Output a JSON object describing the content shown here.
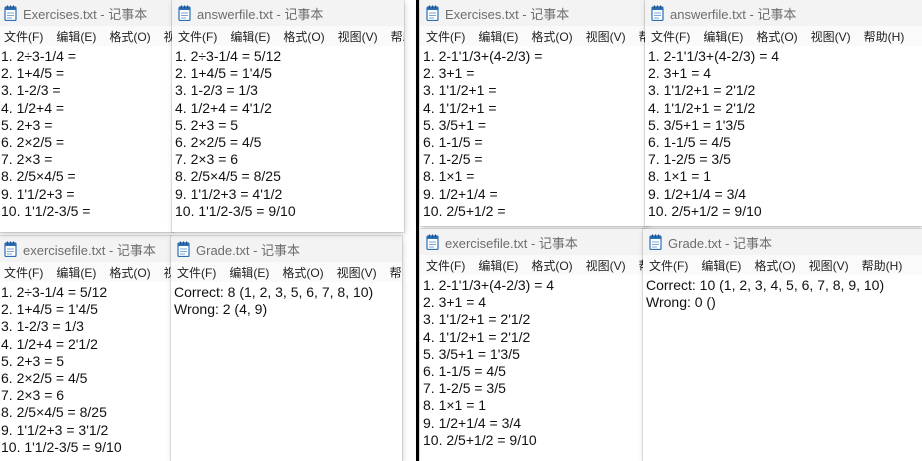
{
  "menu": [
    "文件(F)",
    "编辑(E)",
    "格式(O)",
    "视图(V)",
    "帮助(H)"
  ],
  "windows": {
    "left_exercises": {
      "title": "Exercises.txt - 记事本",
      "lines": [
        "1. 2÷3-1/4 =",
        "2. 1+4/5 =",
        "3. 1-2/3 =",
        "4. 1/2+4 =",
        "5. 2+3 =",
        "6. 2×2/5 =",
        "7. 2×3 =",
        "8. 2/5×4/5 =",
        "9. 1'1/2+3 =",
        "10. 1'1/2-3/5 ="
      ]
    },
    "left_answerfile": {
      "title": "answerfile.txt - 记事本",
      "lines": [
        "1. 2÷3-1/4 = 5/12",
        "2. 1+4/5 = 1'4/5",
        "3. 1-2/3 = 1/3",
        "4. 1/2+4 = 4'1/2",
        "5. 2+3 = 5",
        "6. 2×2/5 = 4/5",
        "7. 2×3 = 6",
        "8. 2/5×4/5 = 8/25",
        "9. 1'1/2+3 = 4'1/2",
        "10. 1'1/2-3/5 = 9/10"
      ]
    },
    "left_exercisefile": {
      "title": "exercisefile.txt - 记事本",
      "lines": [
        "1. 2÷3-1/4 = 5/12",
        "2. 1+4/5 = 1'4/5",
        "3. 1-2/3 = 1/3",
        "4. 1/2+4 = 2'1/2",
        "5. 2+3 = 5",
        "6. 2×2/5 = 4/5",
        "7. 2×3 = 6",
        "8. 2/5×4/5 = 8/25",
        "9. 1'1/2+3 = 3'1/2",
        "10. 1'1/2-3/5 = 9/10"
      ]
    },
    "left_grade": {
      "title": "Grade.txt - 记事本",
      "lines": [
        "Correct: 8 (1, 2, 3, 5, 6, 7, 8, 10)",
        "Wrong: 2 (4, 9)"
      ]
    },
    "right_exercises": {
      "title": "Exercises.txt - 记事本",
      "lines": [
        "1. 2-1'1/3+(4-2/3) =",
        "2. 3+1 =",
        "3. 1'1/2+1 =",
        "4. 1'1/2+1 =",
        "5. 3/5+1 =",
        "6. 1-1/5 =",
        "7. 1-2/5 =",
        "8. 1×1 =",
        "9. 1/2+1/4 =",
        "10. 2/5+1/2 ="
      ]
    },
    "right_answerfile": {
      "title": "answerfile.txt - 记事本",
      "lines": [
        "1. 2-1'1/3+(4-2/3) = 4",
        "2. 3+1 = 4",
        "3. 1'1/2+1 = 2'1/2",
        "4. 1'1/2+1 = 2'1/2",
        "5. 3/5+1 = 1'3/5",
        "6. 1-1/5 = 4/5",
        "7. 1-2/5 = 3/5",
        "8. 1×1 = 1",
        "9. 1/2+1/4 = 3/4",
        "10. 2/5+1/2 = 9/10"
      ]
    },
    "right_exercisefile": {
      "title": "exercisefile.txt - 记事本",
      "lines": [
        "1. 2-1'1/3+(4-2/3) = 4",
        "2. 3+1 = 4",
        "3. 1'1/2+1 = 2'1/2",
        "4. 1'1/2+1 = 2'1/2",
        "5. 3/5+1 = 1'3/5",
        "6. 1-1/5 = 4/5",
        "7. 1-2/5 = 3/5",
        "8. 1×1 = 1",
        "9. 1/2+1/4 = 3/4",
        "10. 2/5+1/2 = 9/10"
      ]
    },
    "right_grade": {
      "title": "Grade.txt - 记事本",
      "lines": [
        "Correct: 10 (1, 2, 3, 4, 5, 6, 7, 8, 9, 10)",
        "Wrong: 0 ()"
      ]
    }
  }
}
